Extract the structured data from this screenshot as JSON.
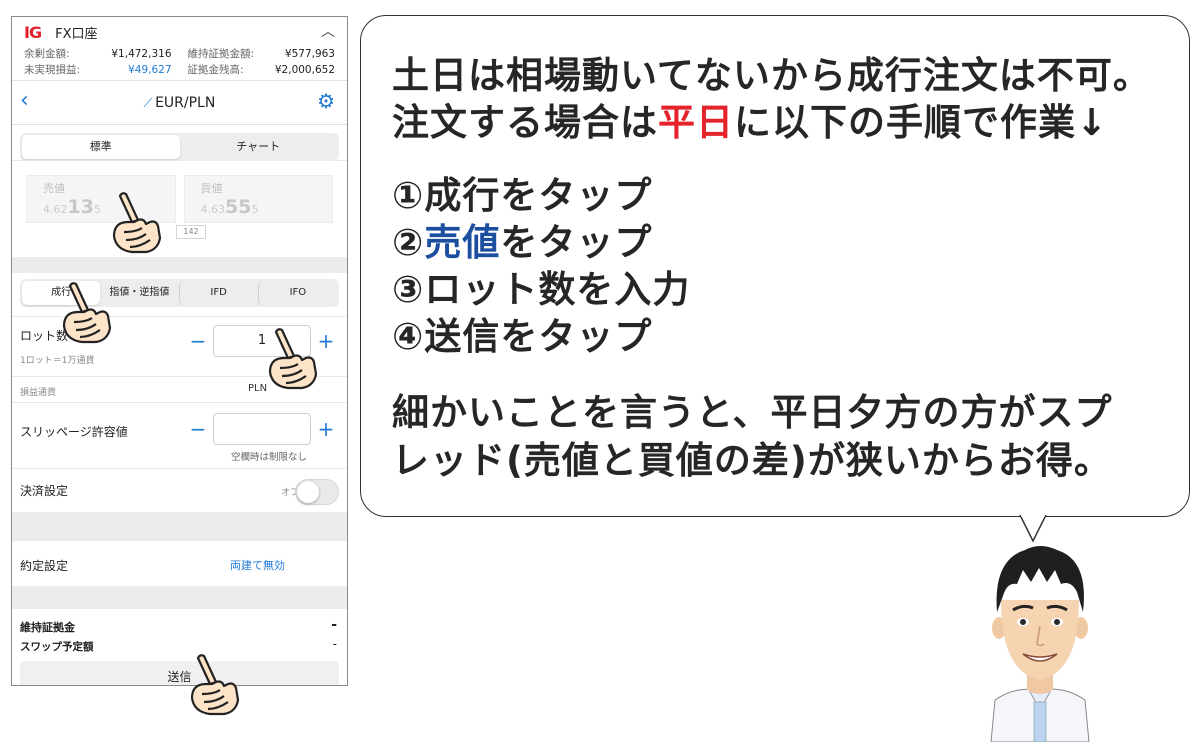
{
  "account": {
    "logo": "IG",
    "name": "FX口座",
    "rows": [
      {
        "label": "余剰金額:",
        "value": "¥1,472,316",
        "blue": false
      },
      {
        "label": "維持証拠金額:",
        "value": "¥577,963",
        "blue": false
      },
      {
        "label": "未実現損益:",
        "value": "¥49,627",
        "blue": true
      },
      {
        "label": "証拠金残高:",
        "value": "¥2,000,652",
        "blue": false
      }
    ]
  },
  "nav": {
    "back": "‹",
    "pair": "EUR/PLN",
    "gear": "⚙"
  },
  "view_tabs": [
    "標準",
    "チャート"
  ],
  "prices": {
    "sell_label": "売値",
    "sell_small": "4.62",
    "sell_big": "13",
    "sell_tail": "5",
    "buy_label": "買値",
    "buy_small": "4.63",
    "buy_big": "55",
    "buy_tail": "5",
    "spread": "142"
  },
  "order_tabs": [
    "成行",
    "指値・逆指値",
    "IFD",
    "IFO"
  ],
  "lot": {
    "label": "ロット数",
    "sub": "1ロット＝1万通貨",
    "value": "1",
    "minus": "−",
    "plus": "+"
  },
  "ccy": {
    "label": "損益通貨",
    "value": "PLN"
  },
  "slippage": {
    "label": "スリッページ許容値",
    "value": "",
    "note": "空欄時は制限なし"
  },
  "settlement": {
    "label": "決済設定",
    "toggle": "オフ"
  },
  "execution": {
    "label": "約定設定",
    "value": "両建て無効"
  },
  "summary": {
    "margin_label": "維持証拠金",
    "margin_value": "-",
    "swap_label": "スワップ予定額",
    "swap_value": "-"
  },
  "submit_label": "送信",
  "bubble": {
    "line1": "土日は相場動いてないから成行注文は不可。",
    "line2_pre": "注文する場合は",
    "line2_red": "平日",
    "line2_post": "に以下の手順で作業↓",
    "step1": "①成行をタップ",
    "step2_num": "②",
    "step2_blue": "売値",
    "step2_post": "をタップ",
    "step3": "③ロット数を入力",
    "step4": "④送信をタップ",
    "note1": "細かいことを言うと、平日夕方の方がスプ",
    "note2": "レッド(売値と買値の差)が狭いからお得。"
  },
  "colors": {
    "accent_blue": "#1f7ad4",
    "red": "#e5232b",
    "dark_blue": "#1c4fa0"
  }
}
